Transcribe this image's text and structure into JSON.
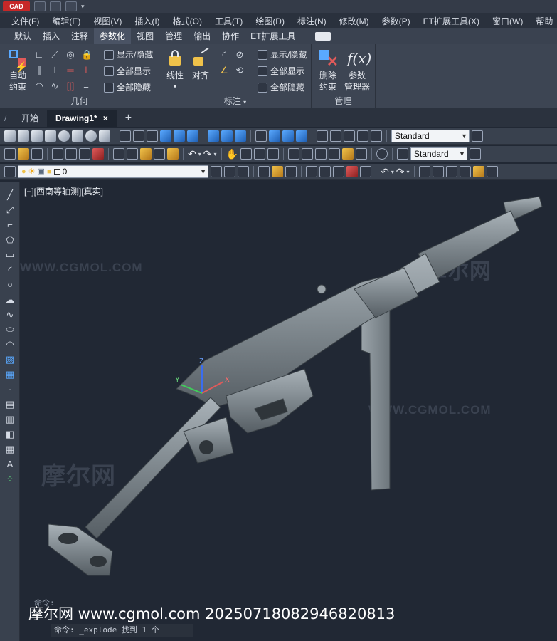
{
  "app": {
    "logo_text": "CAD",
    "accent": "#c62828"
  },
  "menubar": {
    "items": [
      "文件(F)",
      "编辑(E)",
      "视图(V)",
      "插入(I)",
      "格式(O)",
      "工具(T)",
      "绘图(D)",
      "标注(N)",
      "修改(M)",
      "参数(P)",
      "ET扩展工具(X)",
      "窗口(W)",
      "帮助"
    ]
  },
  "ribbon_tabs": {
    "items": [
      "默认",
      "插入",
      "注释",
      "参数化",
      "视图",
      "管理",
      "输出",
      "协作",
      "ET扩展工具"
    ],
    "active_index": 3
  },
  "ribbon": {
    "geometry": {
      "title": "几何",
      "auto_constrain": "自动\n约束",
      "show_hide": "显示/隐藏",
      "show_all": "全部显示",
      "hide_all": "全部隐藏"
    },
    "dimension": {
      "title": "标注",
      "linear": "线性",
      "aligned": "对齐",
      "show_hide": "显示/隐藏",
      "show_all": "全部显示",
      "hide_all": "全部隐藏"
    },
    "manage": {
      "title": "管理",
      "delete_constraints": "删除\n约束",
      "param_manager": "参数\n管理器"
    }
  },
  "file_tabs": {
    "start": "开始",
    "drawing": "Drawing1*",
    "close_glyph": "×",
    "new_glyph": "+"
  },
  "toolbars": {
    "text_style": "Standard",
    "dim_style": "Standard",
    "layer": "0"
  },
  "viewport": {
    "label": "[−][西南等轴测][真实]",
    "bg": "#212834"
  },
  "ucs": {
    "x": "X",
    "y": "Y",
    "z": "Z"
  },
  "watermarks": {
    "url": "WWW.CGMOL.COM",
    "brand": "摩尔网"
  },
  "command": {
    "history_prefix": "命令:",
    "history": "命令: _explode 找到 1 个",
    "input": "命令: _explode 找到 1 个"
  },
  "caption": "摩尔网 www.cgmol.com 20250718082946820813"
}
